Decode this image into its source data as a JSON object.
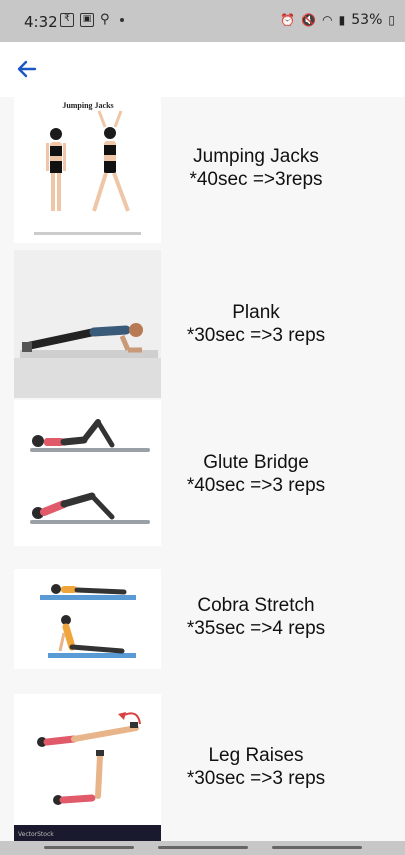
{
  "status_bar": {
    "time": "4:32",
    "battery": "53%"
  },
  "app_bar": {
    "back_icon": "arrow-left-icon",
    "accent": "#1a56c4"
  },
  "exercises": [
    {
      "name": "Jumping Jacks",
      "detail": "*40sec =>3reps",
      "image_title": "Jumping Jacks"
    },
    {
      "name": "Plank",
      "detail": "*30sec =>3 reps"
    },
    {
      "name": "Glute Bridge",
      "detail": "*40sec =>3 reps"
    },
    {
      "name": "Cobra Stretch",
      "detail": "*35sec =>4 reps"
    },
    {
      "name": "Leg Raises",
      "detail": "*30sec =>3 reps"
    }
  ]
}
